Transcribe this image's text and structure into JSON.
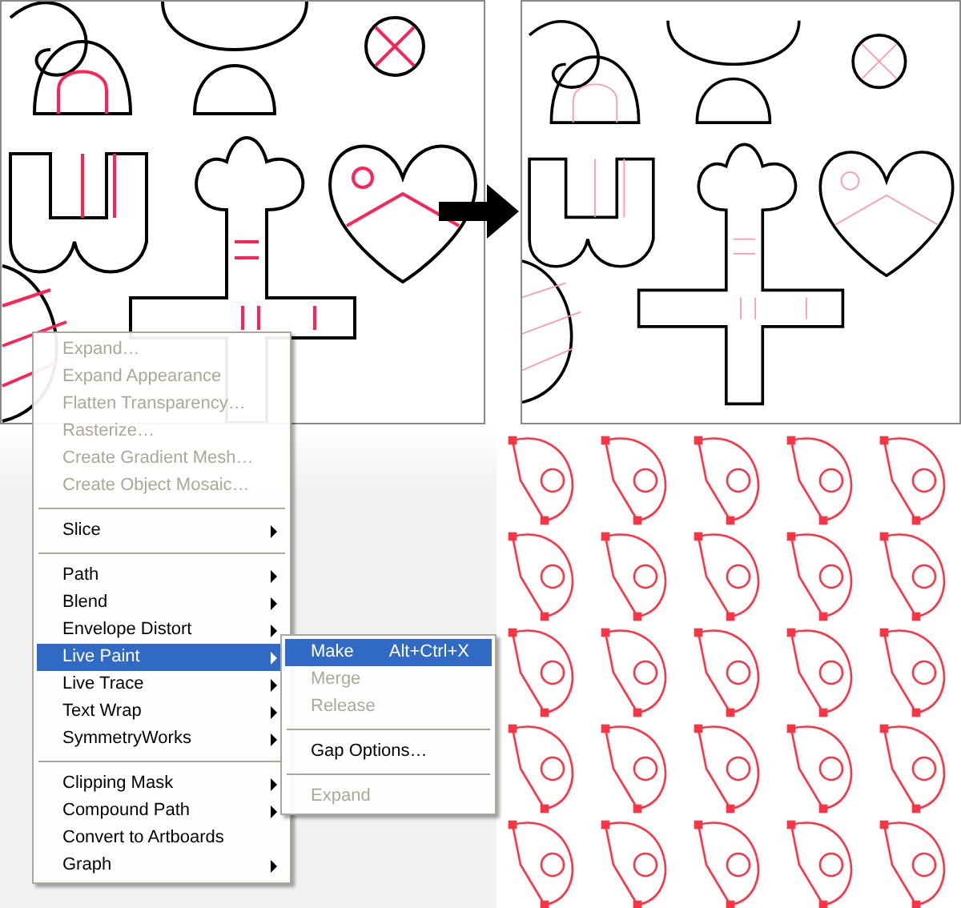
{
  "menu": {
    "items": [
      {
        "kind": "item",
        "label": "Expand…",
        "disabled": true,
        "submenu": false,
        "selected": false
      },
      {
        "kind": "item",
        "label": "Expand Appearance",
        "disabled": true,
        "submenu": false,
        "selected": false
      },
      {
        "kind": "item",
        "label": "Flatten Transparency…",
        "disabled": true,
        "submenu": false,
        "selected": false
      },
      {
        "kind": "item",
        "label": "Rasterize…",
        "disabled": true,
        "submenu": false,
        "selected": false
      },
      {
        "kind": "item",
        "label": "Create Gradient Mesh…",
        "disabled": true,
        "submenu": false,
        "selected": false
      },
      {
        "kind": "item",
        "label": "Create Object Mosaic…",
        "disabled": true,
        "submenu": false,
        "selected": false
      },
      {
        "kind": "separator"
      },
      {
        "kind": "item",
        "label": "Slice",
        "disabled": false,
        "submenu": true,
        "selected": false
      },
      {
        "kind": "separator"
      },
      {
        "kind": "item",
        "label": "Path",
        "disabled": false,
        "submenu": true,
        "selected": false
      },
      {
        "kind": "item",
        "label": "Blend",
        "disabled": false,
        "submenu": true,
        "selected": false
      },
      {
        "kind": "item",
        "label": "Envelope Distort",
        "disabled": false,
        "submenu": true,
        "selected": false
      },
      {
        "kind": "item",
        "label": "Live Paint",
        "disabled": false,
        "submenu": true,
        "selected": true
      },
      {
        "kind": "item",
        "label": "Live Trace",
        "disabled": false,
        "submenu": true,
        "selected": false
      },
      {
        "kind": "item",
        "label": "Text Wrap",
        "disabled": false,
        "submenu": true,
        "selected": false
      },
      {
        "kind": "item",
        "label": "SymmetryWorks",
        "disabled": false,
        "submenu": true,
        "selected": false
      },
      {
        "kind": "separator"
      },
      {
        "kind": "item",
        "label": "Clipping Mask",
        "disabled": false,
        "submenu": true,
        "selected": false
      },
      {
        "kind": "item",
        "label": "Compound Path",
        "disabled": false,
        "submenu": true,
        "selected": false
      },
      {
        "kind": "item",
        "label": "Convert to Artboards",
        "disabled": false,
        "submenu": false,
        "selected": false
      },
      {
        "kind": "item",
        "label": "Graph",
        "disabled": false,
        "submenu": true,
        "selected": false
      }
    ]
  },
  "submenu": {
    "items": [
      {
        "kind": "item",
        "label": "Make",
        "shortcut": "Alt+Ctrl+X",
        "disabled": false,
        "selected": true
      },
      {
        "kind": "item",
        "label": "Merge",
        "disabled": true,
        "selected": false
      },
      {
        "kind": "item",
        "label": "Release",
        "disabled": true,
        "selected": false
      },
      {
        "kind": "separator"
      },
      {
        "kind": "item",
        "label": "Gap Options…",
        "disabled": false,
        "selected": false
      },
      {
        "kind": "separator"
      },
      {
        "kind": "item",
        "label": "Expand",
        "disabled": true,
        "selected": false
      }
    ]
  }
}
